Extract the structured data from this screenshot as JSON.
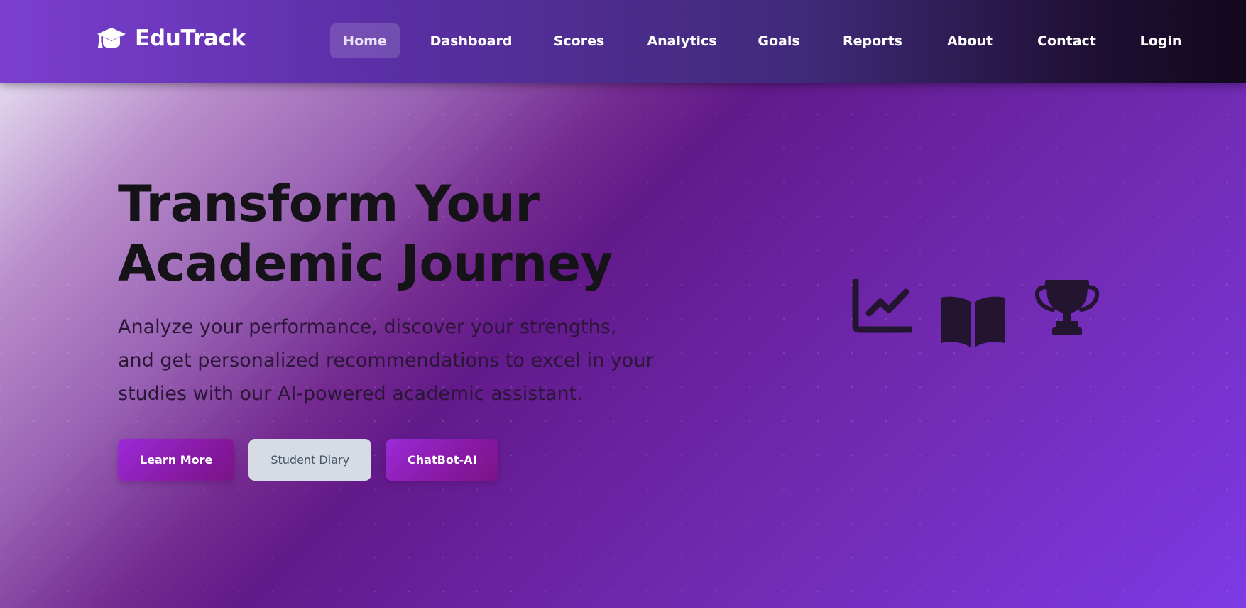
{
  "navbar": {
    "brand": {
      "name": "EduTrack",
      "icon": "graduation-cap-icon"
    },
    "links": [
      {
        "id": "home",
        "label": "Home",
        "active": true
      },
      {
        "id": "dashboard",
        "label": "Dashboard",
        "active": false
      },
      {
        "id": "scores",
        "label": "Scores",
        "active": false
      },
      {
        "id": "analytics",
        "label": "Analytics",
        "active": false
      },
      {
        "id": "goals",
        "label": "Goals",
        "active": false
      },
      {
        "id": "reports",
        "label": "Reports",
        "active": false
      },
      {
        "id": "about",
        "label": "About",
        "active": false
      },
      {
        "id": "contact",
        "label": "Contact",
        "active": false
      },
      {
        "id": "login",
        "label": "Login",
        "active": false
      }
    ]
  },
  "hero": {
    "title_line1": "Transform Your",
    "title_line2": "Academic Journey",
    "description": "Analyze your performance, discover your strengths, and get personalized recommendations to excel in your studies with our AI-powered academic assistant.",
    "buttons": {
      "learn_more": "Learn More",
      "student_diary": "Student Diary",
      "chatbot": "ChatBot-AI"
    },
    "icons": [
      "line-chart-icon",
      "open-book-icon",
      "trophy-icon"
    ]
  },
  "colors": {
    "nav_gradient_start": "#7b3fcf",
    "nav_gradient_end": "#12081f",
    "hero_accent": "#621a8a",
    "primary_button": "#8a1aa8",
    "secondary_button": "#d7dbe3",
    "icon_color": "#23152f"
  }
}
